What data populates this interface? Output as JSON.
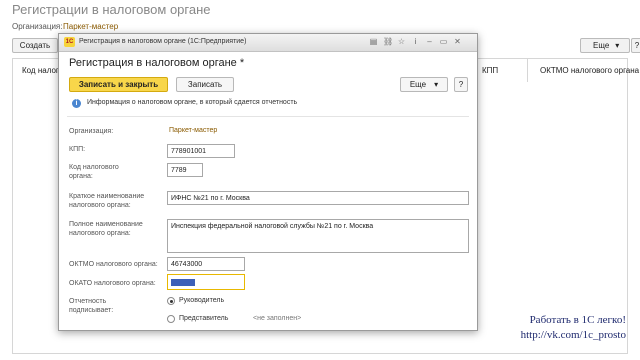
{
  "background": {
    "title": "Регистрации в налоговом органе",
    "org_label": "Организация:",
    "org_value": "Паркет-мастер",
    "create_label": "Создать",
    "more_label": "Еще",
    "more_arrow": "▾",
    "help_label": "?",
    "columns": [
      "Код налогов",
      "КПП",
      "ОКТМО налогового органа"
    ]
  },
  "window": {
    "titlebar": "Регистрация в налоговом органе  (1С:Предприятие)",
    "logo_text": "1С",
    "titlebar_icons": [
      "doc-icon",
      "link-icon",
      "bookmark-icon",
      "info-icon",
      "minimize-icon",
      "restore-icon",
      "close-icon"
    ],
    "titlebar_glyphs": [
      "▤",
      "⛓",
      "☆",
      "i",
      "–",
      "▭",
      "✕"
    ],
    "form_title": "Регистрация в налоговом органе *",
    "save_close_label": "Записать и закрыть",
    "save_label": "Записать",
    "more_label": "Еще",
    "more_arrow": "▾",
    "help_label": "?",
    "info_text": "Информация о налоговом органе, в который сдается отчетность",
    "fields": {
      "org_label": "Организация:",
      "org_value": "Паркет-мастер",
      "kpp_label": "КПП:",
      "kpp_value": "778901001",
      "code_label": "Код налогового органа:",
      "code_value": "7789",
      "short_name_label": "Краткое наименование налогового органа:",
      "short_name_value": "ИФНС №21 по г. Москва",
      "full_name_label": "Полное наименование налогового органа:",
      "full_name_value": "Инспекция федеральной налоговой службы №21 по г. Москва",
      "oktmo_label": "ОКТМО налогового органа:",
      "oktmo_value": "46743000",
      "okato_label": "ОКАТО налогового органа:",
      "okato_value": "",
      "signer_label": "Отчетность подписывает:",
      "signer_options": [
        "Руководитель",
        "Представитель"
      ],
      "signer_selected": "Руководитель",
      "representative_hint": "<не заполнен>"
    }
  },
  "watermark": {
    "line1": "Работать в 1С легко!",
    "line2": "http://vk.com/1c_prosto"
  },
  "colors": {
    "primary_button": "#f8d64a",
    "link": "#8a5a00",
    "focus_border": "#e8b800",
    "selection": "#3c5fb8"
  }
}
